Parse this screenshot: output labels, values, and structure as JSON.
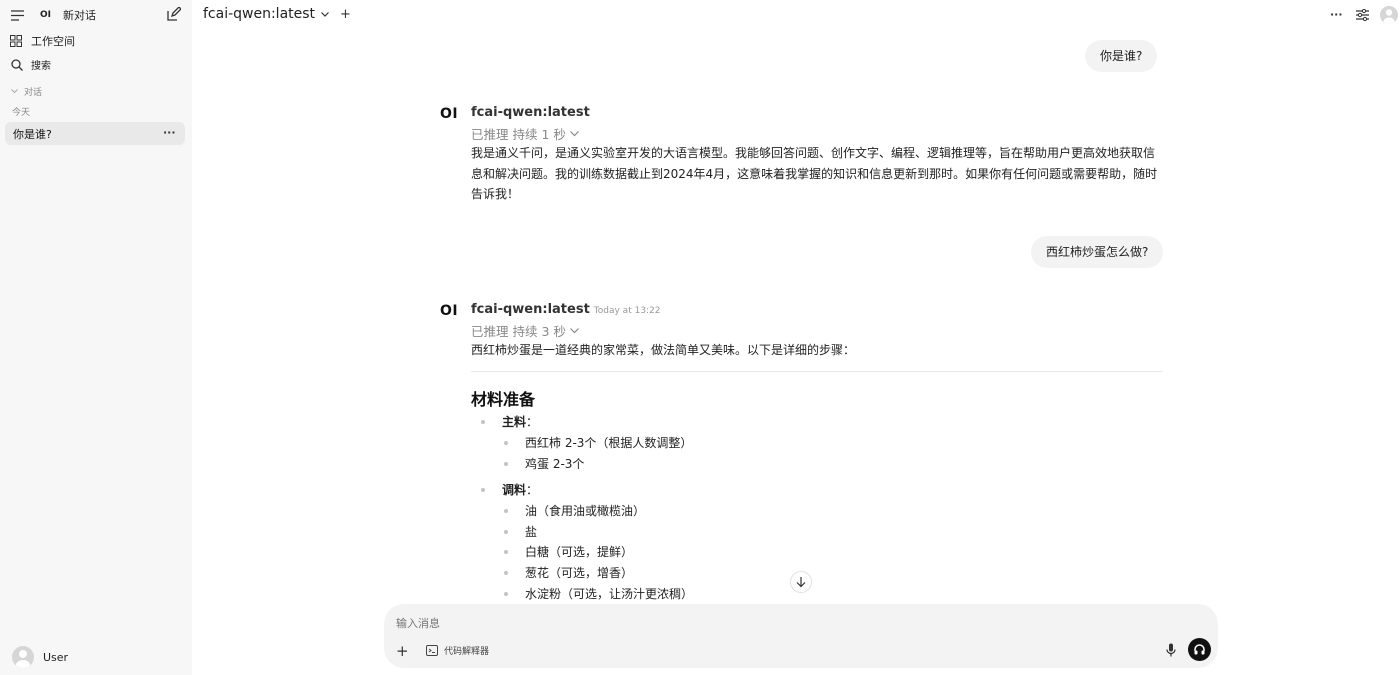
{
  "sidebar": {
    "new_chat": "新对话",
    "workspace": "工作空间",
    "search": "搜索",
    "section_label": "对话",
    "today_label": "今天",
    "chats": [
      {
        "title": "你是谁?"
      }
    ],
    "user_name": "User"
  },
  "header": {
    "model": "fcai-qwen:latest"
  },
  "messages": [
    {
      "role": "user",
      "text": "你是谁?"
    },
    {
      "role": "assistant",
      "model": "fcai-qwen:latest",
      "reasoning": "已推理 持续 1 秒",
      "content": "我是通义千问，是通义实验室开发的大语言模型。我能够回答问题、创作文字、编程、逻辑推理等，旨在帮助用户更高效地获取信息和解决问题。我的训练数据截止到2024年4月，这意味着我掌握的知识和信息更新到那时。如果你有任何问题或需要帮助，随时告诉我！"
    },
    {
      "role": "user",
      "text": "西红柿炒蛋怎么做?"
    },
    {
      "role": "assistant",
      "model": "fcai-qwen:latest",
      "timestamp": "Today at 13:22",
      "reasoning": "已推理 持续 3 秒",
      "intro": "西红柿炒蛋是一道经典的家常菜，做法简单又美味。以下是详细的步骤：",
      "heading": "材料准备",
      "groups": [
        {
          "label": "主料",
          "items": [
            "西红柿 2-3个（根据人数调整）",
            "鸡蛋 2-3个"
          ]
        },
        {
          "label": "调料",
          "items": [
            "油（食用油或橄榄油）",
            "盐",
            "白糖（可选，提鲜）",
            "葱花（可选，增香）",
            "水淀粉（可选，让汤汁更浓稠）"
          ]
        }
      ]
    }
  ],
  "composer": {
    "placeholder": "输入消息",
    "code_interpreter": "代码解释器"
  },
  "logo_text": "OI",
  "colors": {
    "accent": "#111111",
    "sidebar_bg": "#f7f7f7",
    "bubble_bg": "#f3f3f3",
    "muted": "#888888"
  }
}
